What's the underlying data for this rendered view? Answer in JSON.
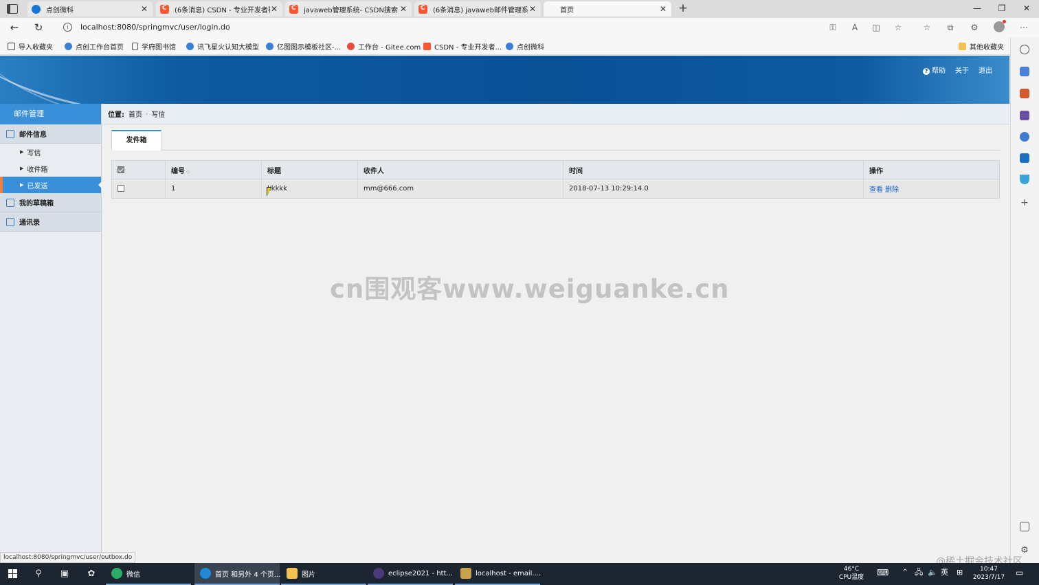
{
  "browser": {
    "tabs": [
      {
        "title": "点创微科",
        "favicon": "dianchuang-icon"
      },
      {
        "title": "(6条消息) CSDN - 专业开发者社区",
        "favicon": "csdn-icon"
      },
      {
        "title": "javaweb管理系统- CSDN搜索",
        "favicon": "csdn-icon"
      },
      {
        "title": "(6条消息) javaweb邮件管理系统_",
        "favicon": "csdn-icon"
      },
      {
        "title": "首页",
        "favicon": "page-icon"
      }
    ],
    "url": "localhost:8080/springmvc/user/login.do",
    "bookmarks": [
      "导入收藏夹",
      "点创工作台首页",
      "学府图书馆",
      "讯飞星火认知大模型",
      "亿图图示模板社区-...",
      "工作台 - Gitee.com",
      "CSDN - 专业开发者...",
      "点创微科"
    ],
    "other_bookmarks": "其他收藏夹",
    "status_url": "localhost:8080/springmvc/user/outbox.do"
  },
  "app": {
    "top_links": {
      "help": "帮助",
      "about": "关于",
      "logout": "退出"
    },
    "sidebar": {
      "title": "邮件管理",
      "groups": [
        {
          "label": "邮件信息",
          "items": [
            {
              "label": "写信"
            },
            {
              "label": "收件箱"
            },
            {
              "label": "已发送"
            }
          ]
        },
        {
          "label": "我的草稿箱"
        },
        {
          "label": "通讯录"
        }
      ]
    },
    "breadcrumb": {
      "label": "位置:",
      "items": [
        "首页",
        "写信"
      ]
    },
    "tab": "发件箱",
    "table": {
      "columns": [
        "编号",
        "标题",
        "收件人",
        "时间",
        "操作"
      ],
      "rows": [
        {
          "id": "1",
          "title": "kkkkk",
          "recipient": "mm@666.com",
          "time": "2018-07-13 10:29:14.0",
          "actions": [
            "查看",
            "删除"
          ]
        }
      ]
    }
  },
  "watermarks": {
    "center": "cn围观客www.weiguanke.cn",
    "corner": "@稀土掘金技术社区"
  },
  "taskbar": {
    "apps": [
      "微信",
      "首页 和另外 4 个页...",
      "图片",
      "eclipse2021 - htt...",
      "localhost - email...."
    ],
    "temp": "46°C",
    "temp_label": "CPU温度",
    "ime": "英",
    "time": "10:47",
    "date": "2023/7/17"
  },
  "colors": {
    "banner": "#0a5196",
    "nav_active": "#3a8fd9",
    "link": "#1a62c5"
  }
}
